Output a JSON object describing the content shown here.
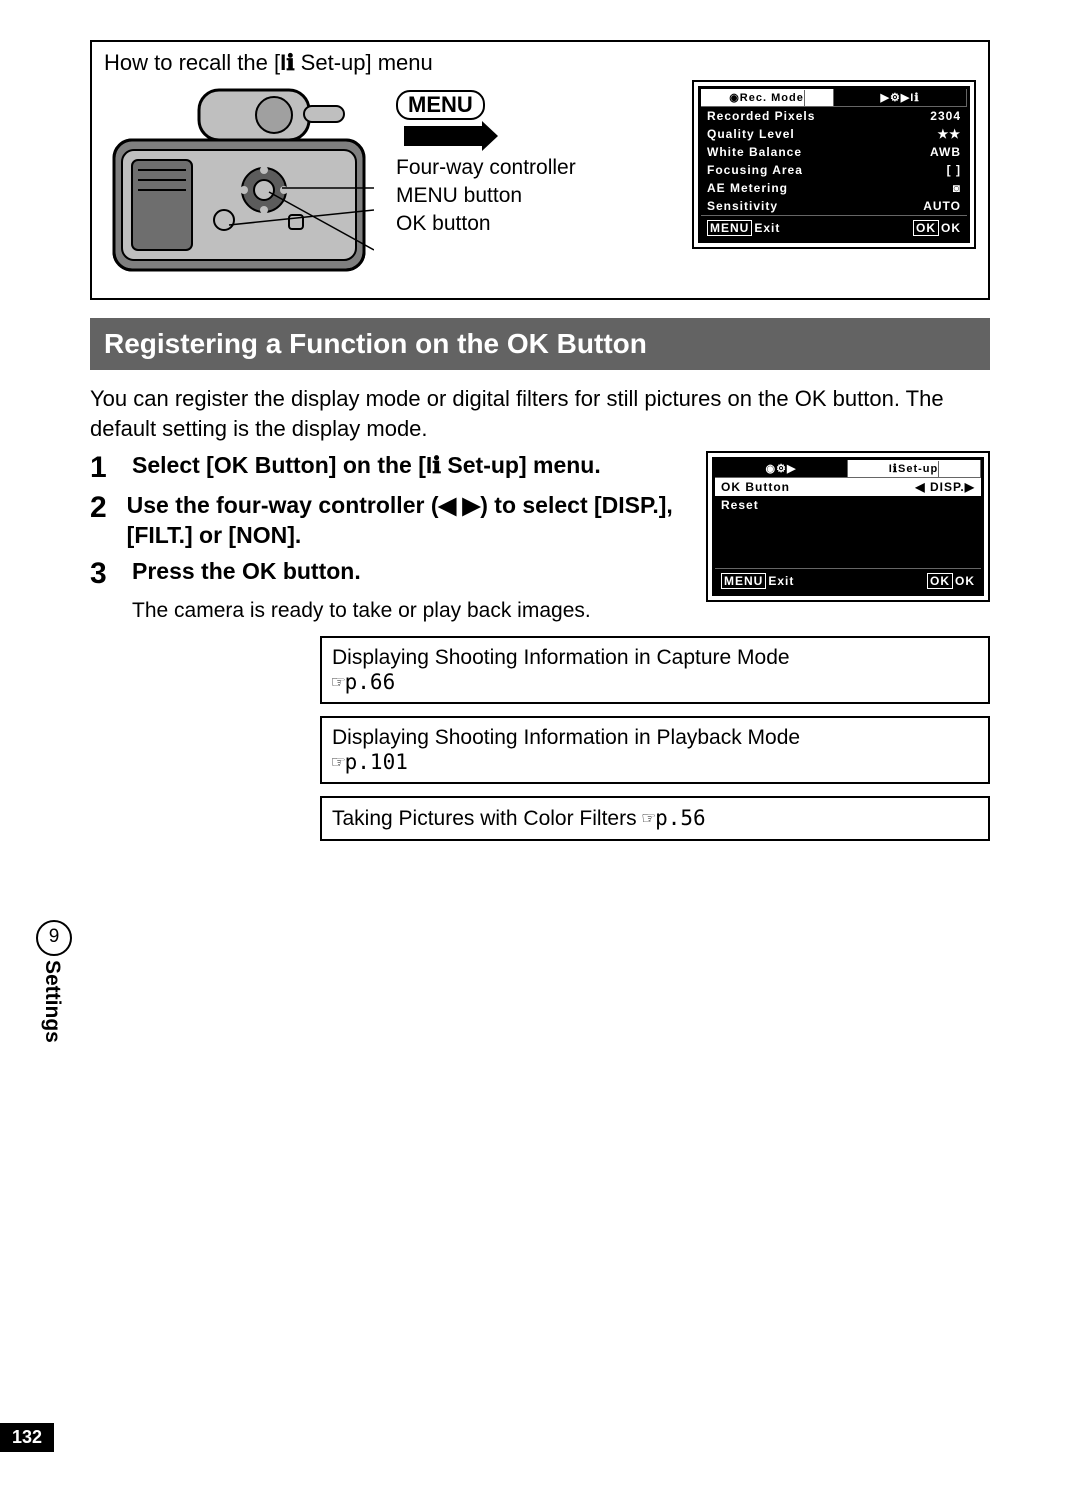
{
  "topbox": {
    "howto_pre": "How to recall the [",
    "howto_post": " Set-up] menu",
    "setup_icon": "Iℹ",
    "menu_pill": "MENU",
    "labels": {
      "fourway": "Four-way controller",
      "menubtn": "MENU button",
      "okbtn": "OK button"
    }
  },
  "lcd1": {
    "title": "Rec. Mode",
    "tab_icons": [
      "▶",
      "⚙",
      "▶",
      "Iℹ"
    ],
    "rows": [
      {
        "k": "Recorded Pixels",
        "v": "2304"
      },
      {
        "k": "Quality Level",
        "v": "★★"
      },
      {
        "k": "White Balance",
        "v": "AWB"
      },
      {
        "k": "Focusing Area",
        "v": "[  ]"
      },
      {
        "k": "AE Metering",
        "v": "◙"
      },
      {
        "k": "Sensitivity",
        "v": "AUTO"
      }
    ],
    "foot_menu": "MENU",
    "foot_exit": "Exit",
    "foot_ok": "OK",
    "foot_oklbl": "OK"
  },
  "blackbar": "Registering a Function on the OK Button",
  "para": "You can register the display mode or digital filters for still pictures on the OK button. The default setting is the display mode.",
  "steps": [
    {
      "n": "1",
      "t_pre": "Select [OK Button] on the [",
      "t_post": " Set-up] menu."
    },
    {
      "n": "2",
      "t": "Use the four-way controller (◀ ▶) to select [DISP.], [FILT.] or [NON]."
    },
    {
      "n": "3",
      "t": "Press the OK button."
    }
  ],
  "sub3": "The camera is ready to take or play back images.",
  "lcd2": {
    "title": "Set-up",
    "tab_icons": [
      "📷",
      "⚙",
      "▶",
      "Iℹ"
    ],
    "rows": [
      {
        "k": "OK Button",
        "v": "◀ DISP.▶"
      },
      {
        "k": "Reset",
        "v": ""
      }
    ],
    "foot_menu": "MENU",
    "foot_exit": "Exit",
    "foot_ok": "OK",
    "foot_oklbl": "OK"
  },
  "refs": [
    {
      "t": "Displaying Shooting Information in Capture Mode",
      "p": "☞p.66"
    },
    {
      "t": "Displaying Shooting Information in Playback Mode",
      "p": "☞p.101"
    },
    {
      "t": "Taking Pictures with Color Filters ",
      "p": "☞p.56",
      "inline": true
    }
  ],
  "sidetab": {
    "num": "9",
    "label": "Settings"
  },
  "pagenum": "132"
}
